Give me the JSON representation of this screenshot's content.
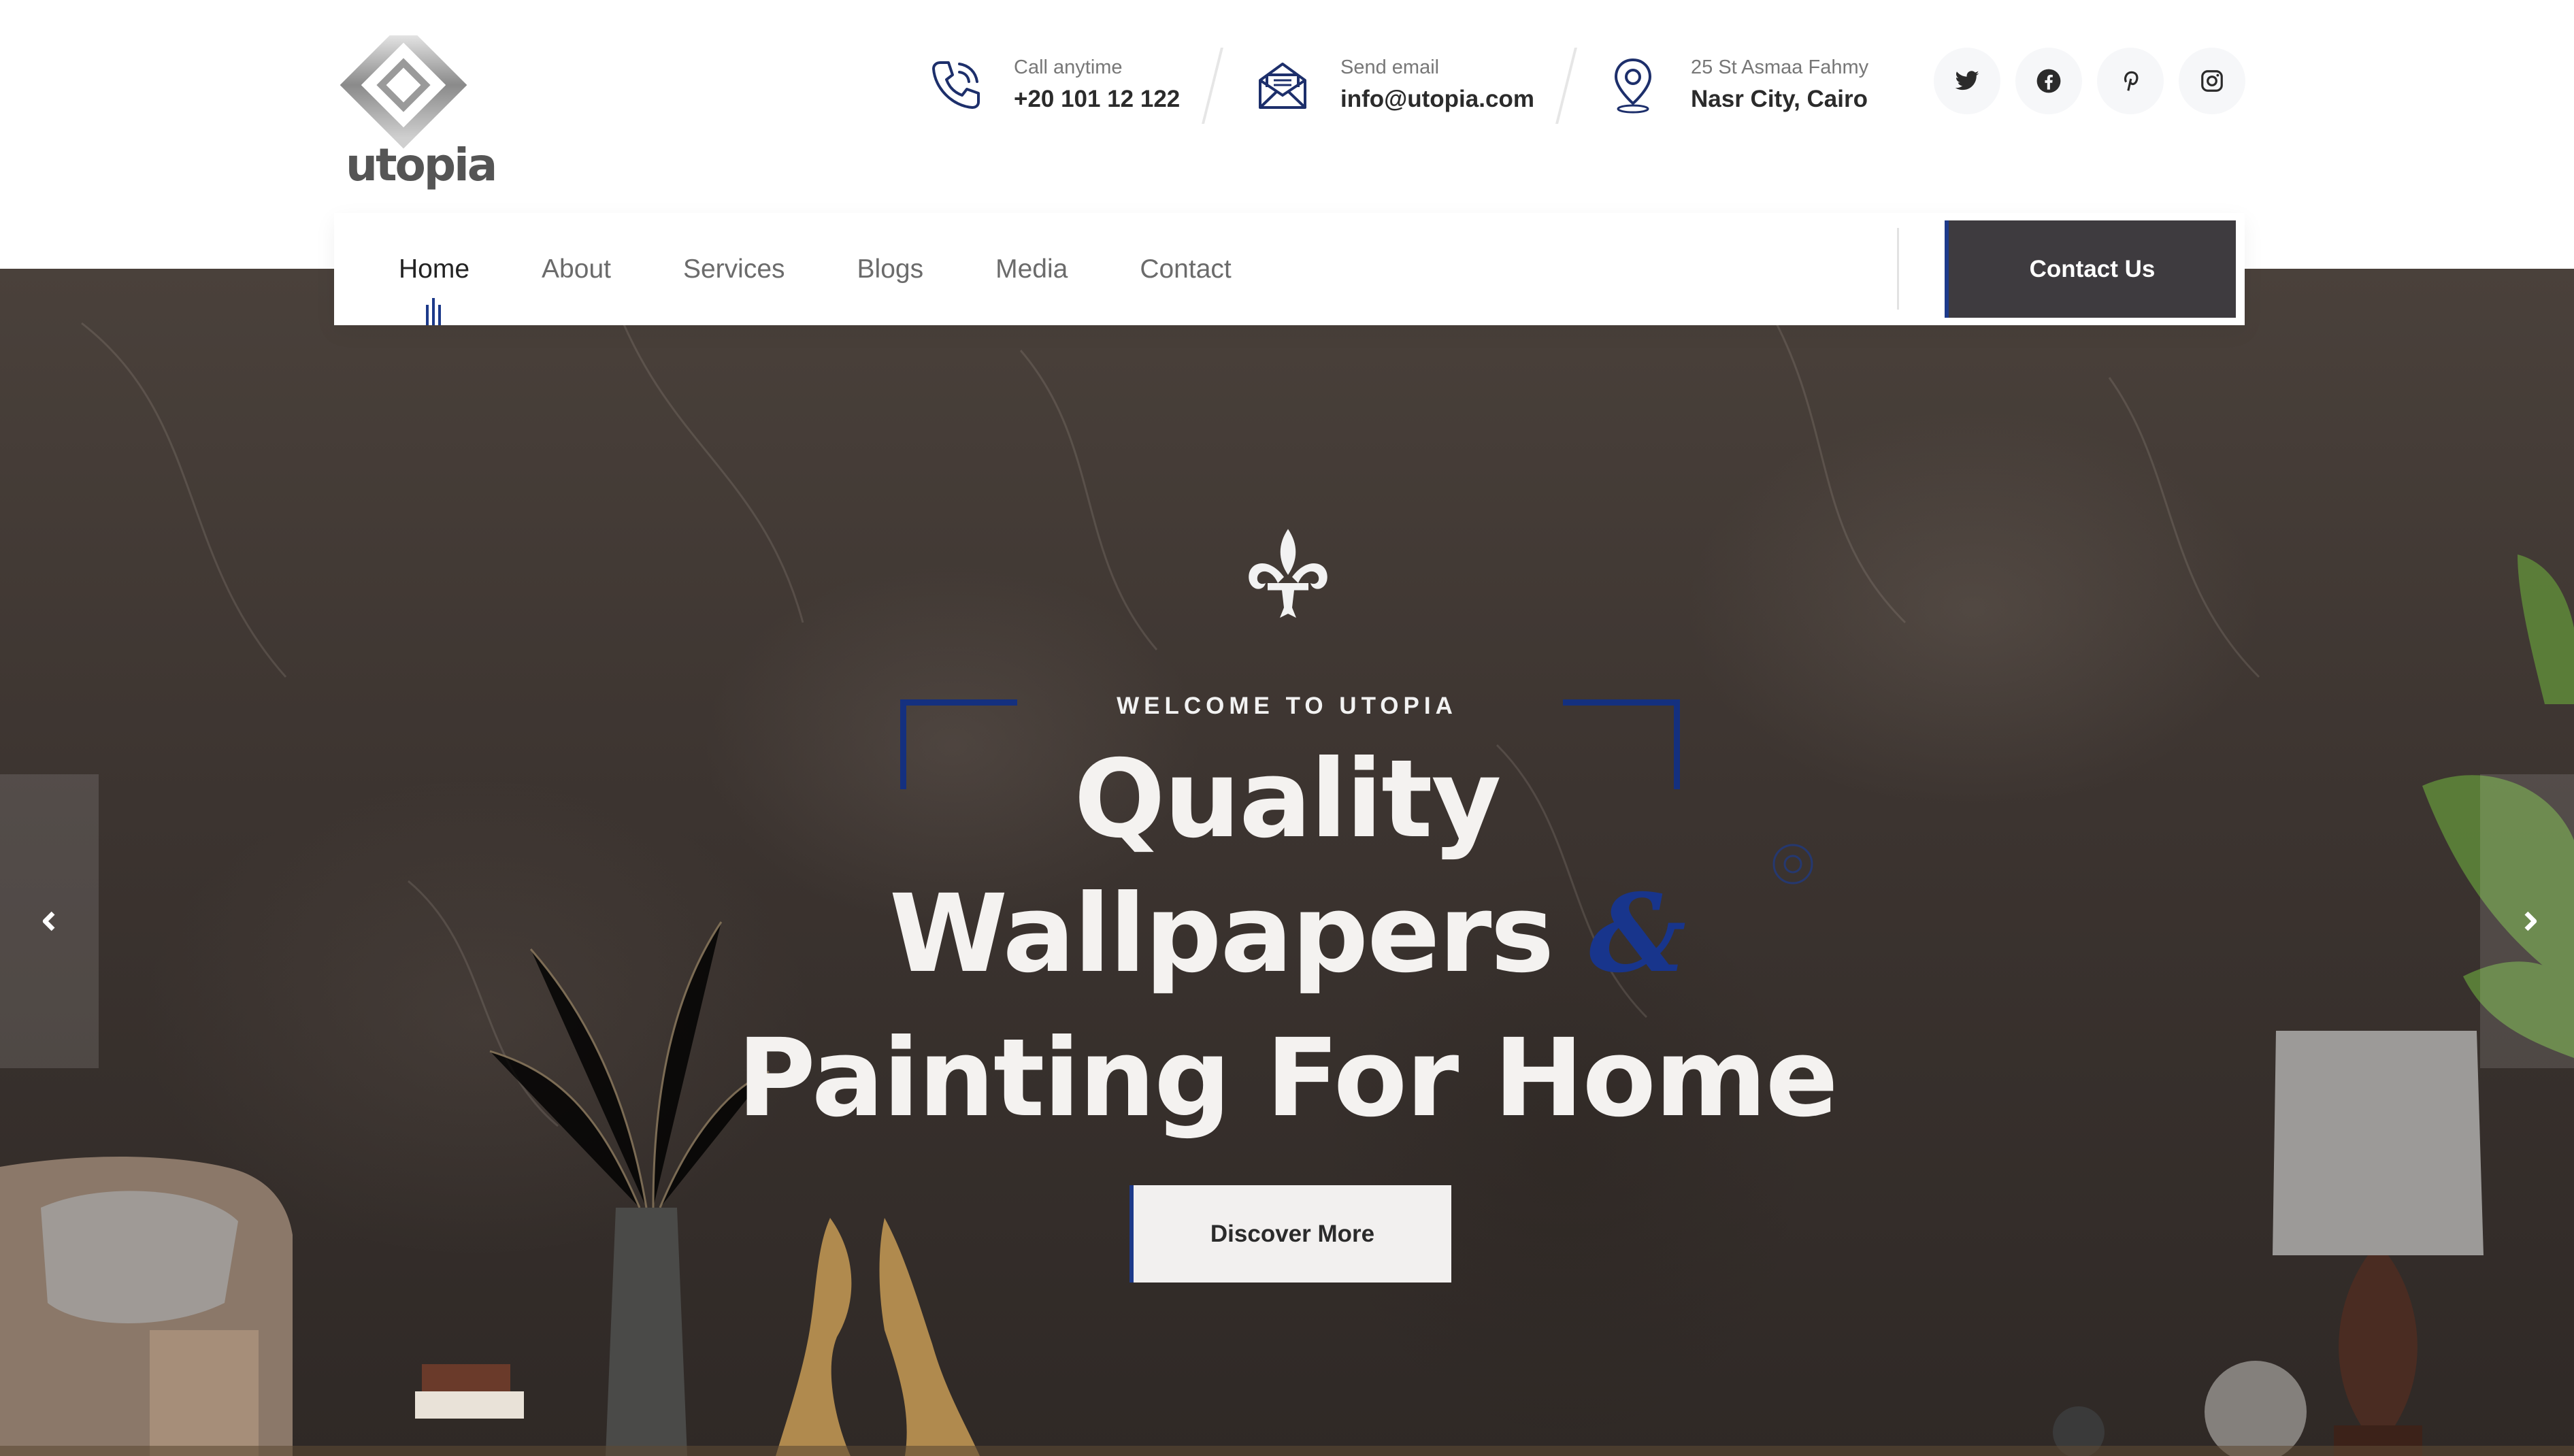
{
  "header": {
    "logo_text": "utopia",
    "contacts": [
      {
        "icon": "phone-icon",
        "label": "Call anytime",
        "value": "+20 101 12 122"
      },
      {
        "icon": "envelope-icon",
        "label": "Send email",
        "value": "info@utopia.com"
      },
      {
        "icon": "location-pin-icon",
        "label": "25 St Asmaa Fahmy",
        "value": "Nasr City, Cairo"
      }
    ],
    "socials": [
      "twitter-icon",
      "facebook-icon",
      "pinterest-icon",
      "instagram-icon"
    ]
  },
  "nav": {
    "items": [
      {
        "label": "Home",
        "active": true
      },
      {
        "label": "About",
        "active": false
      },
      {
        "label": "Services",
        "active": false
      },
      {
        "label": "Blogs",
        "active": false
      },
      {
        "label": "Media",
        "active": false
      },
      {
        "label": "Contact",
        "active": false
      }
    ],
    "cta_label": "Contact Us"
  },
  "hero": {
    "welcome": "WELCOME TO UTOPIA",
    "line1": "Quality",
    "line2_main": "Wallpapers",
    "line2_amp": "&",
    "line3": "Painting For Home",
    "button_label": "Discover More"
  },
  "colors": {
    "accent_blue": "#14307f",
    "button_dark": "#3e3b3f",
    "hero_dark": "#3c3430"
  }
}
